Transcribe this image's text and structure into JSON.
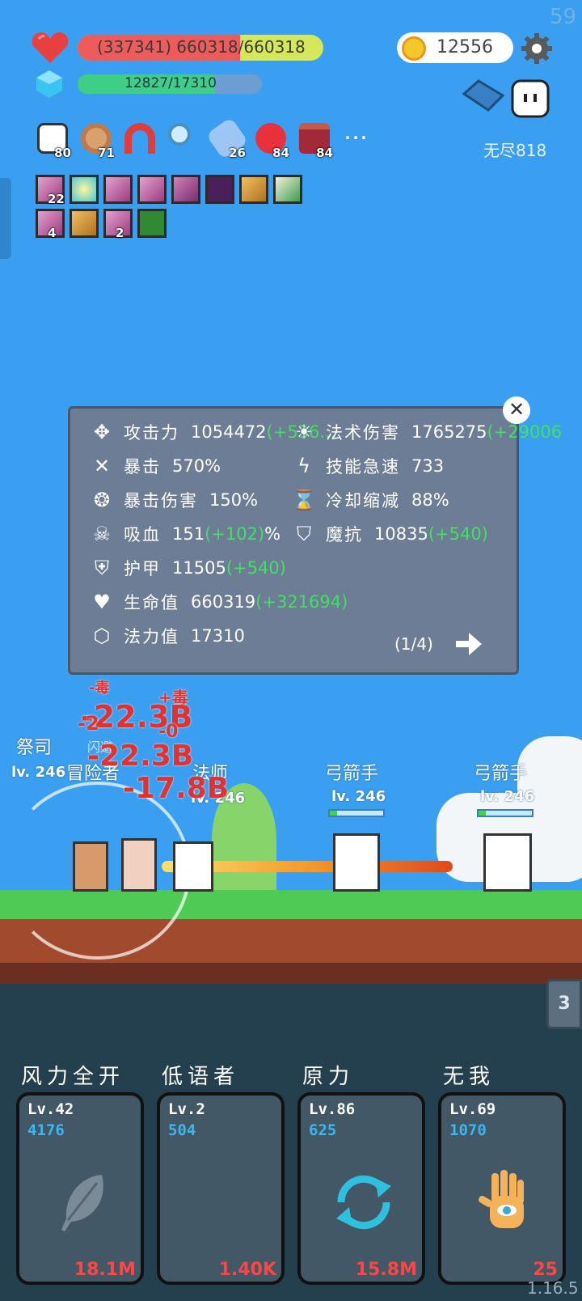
{
  "fps": "59",
  "hud": {
    "hp_text": "(337341) 660318/660318",
    "hp_fraction": 0.66,
    "mp_text": "12827/17310",
    "mp_fraction": 0.74,
    "gold": "12556",
    "endless_label": "无尽818"
  },
  "items": [
    {
      "icon": "star-card-icon",
      "count": "80",
      "color": "#ffffff"
    },
    {
      "icon": "donut-icon",
      "count": "71",
      "color": "#d9a070"
    },
    {
      "icon": "magnet-icon",
      "count": "",
      "color": "#e03c3c"
    },
    {
      "icon": "magnifier-icon",
      "count": "",
      "color": "#7ecbf5"
    },
    {
      "icon": "eraser-icon",
      "count": "26",
      "color": "#9dc6f5"
    },
    {
      "icon": "apple-icon",
      "count": "84",
      "color": "#e8313a"
    },
    {
      "icon": "jam-jar-icon",
      "count": "84",
      "color": "#a3283a"
    }
  ],
  "buffs": [
    {
      "icon": "sword-buff-icon",
      "count": "22",
      "color": "#c96aa8"
    },
    {
      "icon": "sun-buff-icon",
      "count": "",
      "color": "#49c8d4"
    },
    {
      "icon": "sword-buff-icon",
      "count": "",
      "color": "#c96aa8"
    },
    {
      "icon": "sword-buff-icon",
      "count": "",
      "color": "#c96aa8"
    },
    {
      "icon": "sword-buff-icon",
      "count": "",
      "color": "#b05090"
    },
    {
      "icon": "dark-buff-icon",
      "count": "",
      "color": "#5a2a6a"
    },
    {
      "icon": "shield-buff-icon",
      "count": "",
      "color": "#d79a3a"
    },
    {
      "icon": "leaf-buff-icon",
      "count": "",
      "color": "#3f9a4a"
    },
    {
      "icon": "sword-buff-icon",
      "count": "4",
      "color": "#c96aa8"
    },
    {
      "icon": "shield-buff-icon",
      "count": "",
      "color": "#d79a3a"
    },
    {
      "icon": "sword-buff-icon",
      "count": "2",
      "color": "#c96aa8"
    },
    {
      "icon": "green-rune-icon",
      "count": "",
      "color": "#2f8a32"
    }
  ],
  "stats": {
    "attack": {
      "name": "攻击力",
      "value": "1054472",
      "bonus": "(+536..."
    },
    "magic": {
      "name": "法术伤害",
      "value": "1765275",
      "bonus": "(+29006"
    },
    "crit": {
      "name": "暴击",
      "value": "570%"
    },
    "haste": {
      "name": "技能急速",
      "value": "733"
    },
    "crit_dmg": {
      "name": "暴击伤害",
      "value": "150%"
    },
    "cdr": {
      "name": "冷却缩减",
      "value": "88%"
    },
    "lifesteal": {
      "name": "吸血",
      "value": "151",
      "bonus": "(+102)",
      "suffix": "%"
    },
    "mres": {
      "name": "魔抗",
      "value": "10835",
      "bonus": "(+540)"
    },
    "armor": {
      "name": "护甲",
      "value": "11505",
      "bonus": "(+540)"
    },
    "hp": {
      "name": "生命值",
      "value": "660319",
      "bonus": "(+321694)"
    },
    "mp": {
      "name": "法力值",
      "value": "17310"
    },
    "page": "(1/4)"
  },
  "battle": {
    "allies": [
      "祭司",
      "冒险者",
      "法师"
    ],
    "ally_levels": [
      "lv. 246",
      "lv. 246"
    ],
    "dodge": "闪避",
    "enemies": [
      {
        "name": "弓箭手",
        "level": "lv. 246",
        "hp_fraction": 0.14
      },
      {
        "name": "弓箭手",
        "level": "lv. 246",
        "hp_fraction": 0.14
      }
    ],
    "damage": [
      "-毒",
      "+毒",
      "-22.3B",
      "-22.3B",
      "-17.8B",
      "-2",
      "-0"
    ],
    "wave": "3"
  },
  "skills": [
    {
      "name": "风力全开",
      "level": "Lv.42",
      "power": "4176",
      "cost": "18.1M",
      "icon": "feather-icon"
    },
    {
      "name": "低语者",
      "level": "Lv.2",
      "power": "504",
      "cost": "1.40K",
      "icon": "crescent-moon-icon"
    },
    {
      "name": "原力",
      "level": "Lv.86",
      "power": "625",
      "cost": "15.8M",
      "icon": "cycle-arrows-icon"
    },
    {
      "name": "无我",
      "level": "Lv.69",
      "power": "1070",
      "cost": "25",
      "icon": "eye-hand-icon"
    }
  ],
  "version": "1.16.5"
}
